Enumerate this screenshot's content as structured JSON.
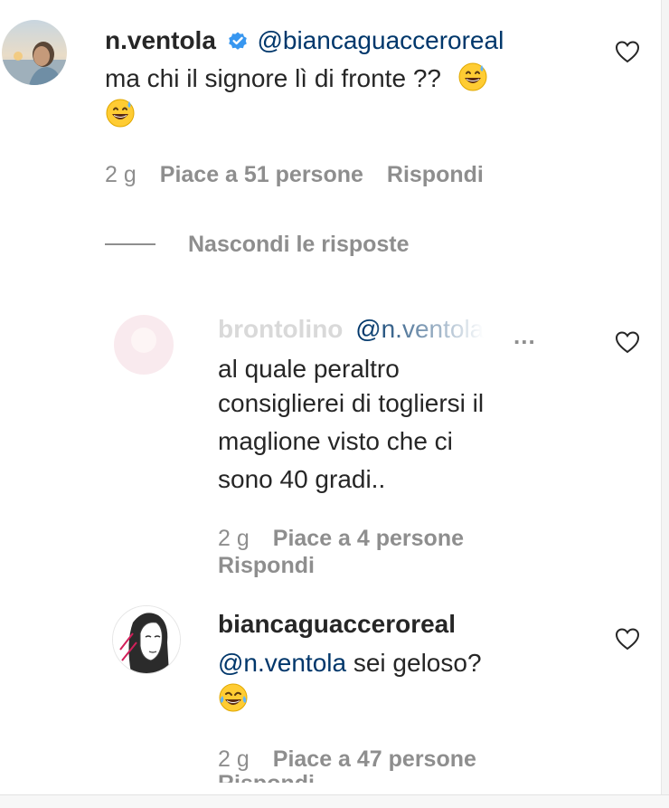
{
  "comment": {
    "username": "n.ventola",
    "mention": "@biancaguacceroreal",
    "text_line1": "ma chi il signore lì di fronte ??",
    "time": "2 g",
    "likes": "Piace a 51 persone",
    "reply": "Rispondi",
    "icons": [
      "avatar-photo",
      "verified-badge-icon",
      "grinning-sweat-emoji",
      "heart-icon"
    ]
  },
  "replies_toggle": {
    "label": "Nascondi le risposte"
  },
  "reply1": {
    "username": "brontolino",
    "mention": "@n.ventola",
    "more": "...",
    "text_lines": [
      "al quale peraltro",
      "consiglierei di togliersi il",
      "maglione visto che ci",
      "sono 40 gradi.."
    ],
    "time": "2 g",
    "likes": "Piace a 4 persone",
    "reply": "Rispondi"
  },
  "reply2": {
    "username": "biancaguacceroreal",
    "mention": "@n.ventola",
    "text": "sei geloso?",
    "time": "2 g",
    "likes": "Piace a 47 persone",
    "reply": "Rispondi",
    "icons": [
      "avatar-sketch",
      "tears-of-joy-emoji",
      "heart-icon"
    ]
  },
  "colors": {
    "text": "#262626",
    "meta": "#8e8e8e",
    "mention": "#00376b",
    "verified": "#3897f0"
  }
}
